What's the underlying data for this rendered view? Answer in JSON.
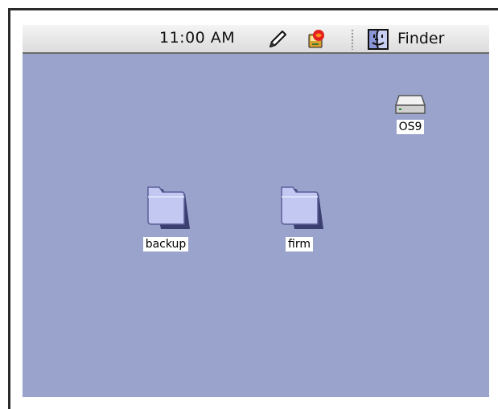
{
  "menubar": {
    "clock": "11:00 AM",
    "active_app": "Finder"
  },
  "desktop": {
    "drive": {
      "label": "OS9",
      "icon": "hard-drive-icon"
    },
    "folders": [
      {
        "label": "backup",
        "icon": "folder-icon"
      },
      {
        "label": "firm",
        "icon": "folder-icon"
      }
    ]
  },
  "colors": {
    "desktop_background": "#9aa3cc",
    "menubar": "#e6e6e6",
    "folder": "#b9bfee"
  }
}
